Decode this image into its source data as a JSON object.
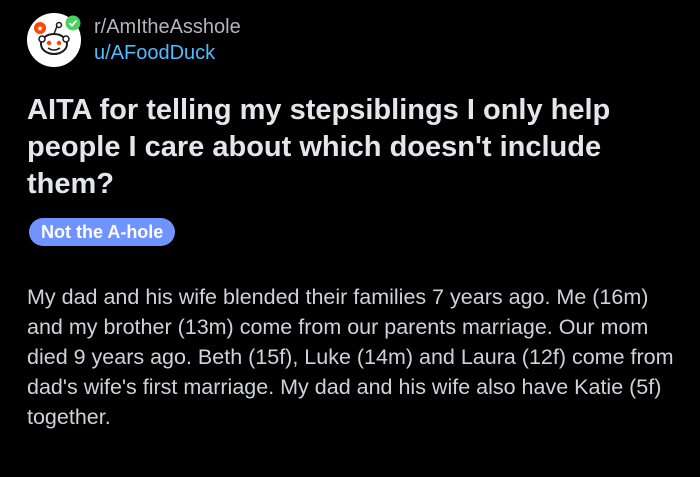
{
  "post": {
    "subreddit": "r/AmItheAsshole",
    "username": "u/AFoodDuck",
    "title": "AITA for telling my stepsiblings I only help people I care about which doesn't include them?",
    "flair": "Not the A-hole",
    "body": "My dad and his wife blended their families 7 years ago. Me (16m) and my brother (13m) come from our parents marriage. Our mom died 9 years ago. Beth (15f), Luke (14m) and Laura (12f) come from dad's wife's first marriage. My dad and his wife also have Katie (5f) together."
  },
  "icons": {
    "avatar": "snoo-avatar-icon",
    "badge": "verified-badge-icon"
  },
  "colors": {
    "background": "#000000",
    "username": "#4fbcff",
    "flair_bg": "#7193ff",
    "badge_green": "#46d160",
    "badge_orange": "#ff4500"
  }
}
